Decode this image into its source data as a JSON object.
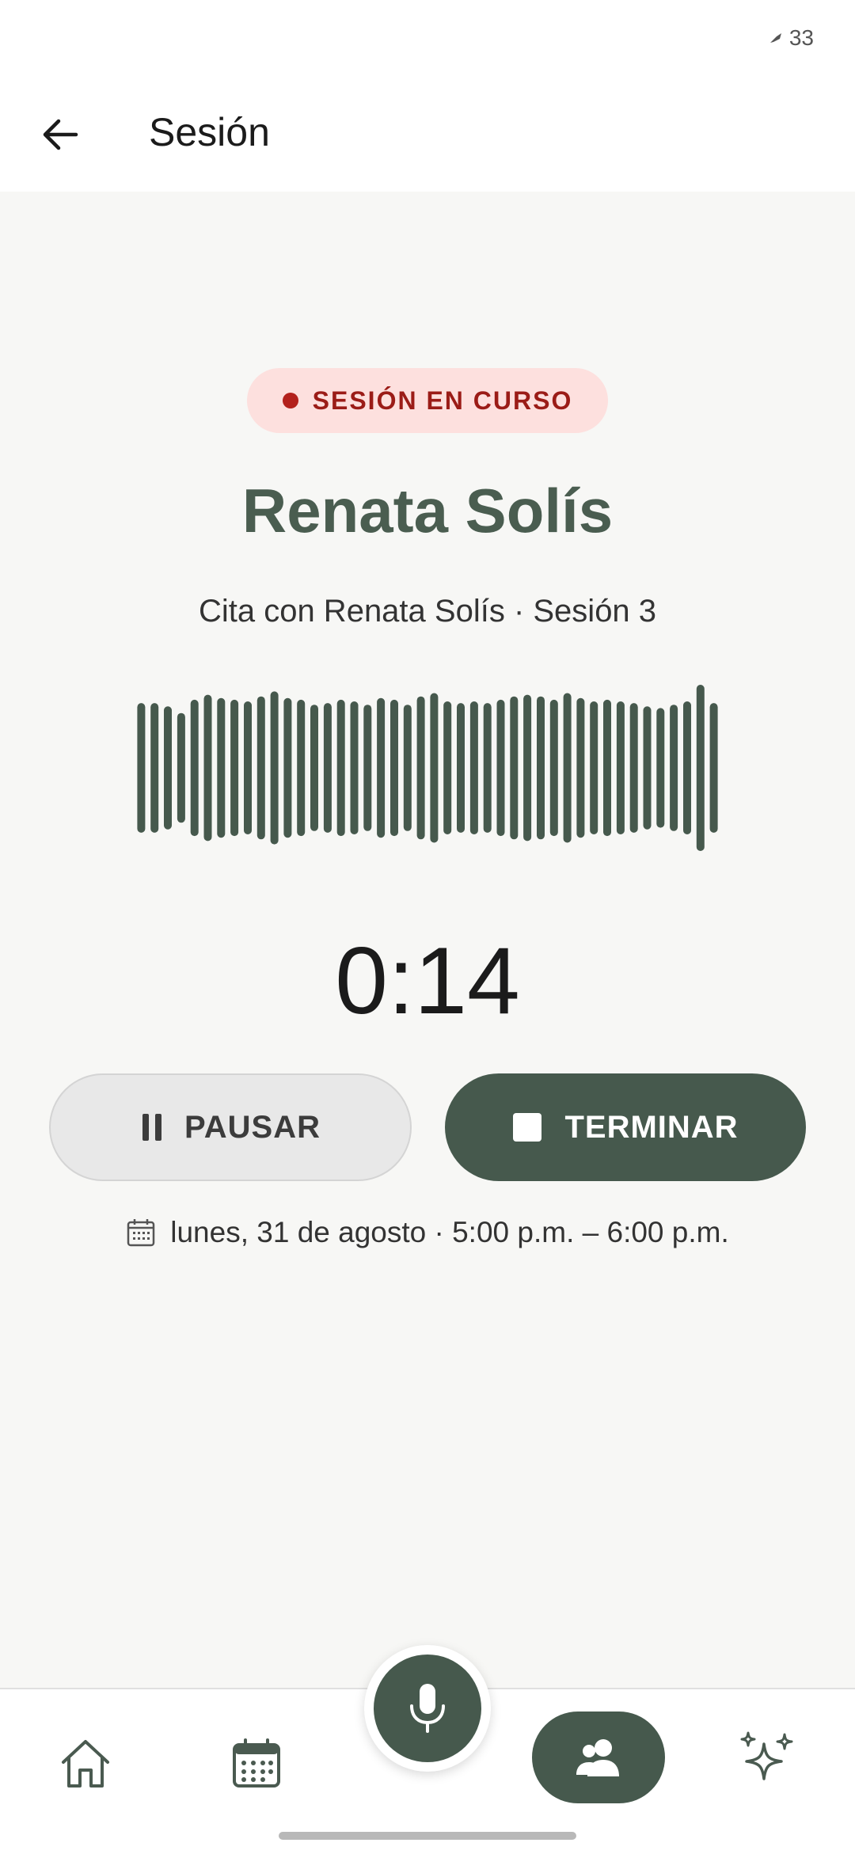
{
  "status_bar": {
    "battery": "33",
    "battery_icon": "battery-saver-icon"
  },
  "app_bar": {
    "title": "Sesión",
    "back_icon": "arrow-left-icon"
  },
  "badge": {
    "label": "SESIÓN EN CURSO",
    "dot_color": "#b3211c"
  },
  "client": {
    "name": "Renata Solís",
    "subtitle": "Cita con Renata Solís · Sesión 3"
  },
  "recording": {
    "elapsed": "0:14",
    "waveform_levels": [
      0.78,
      0.78,
      0.74,
      0.66,
      0.82,
      0.88,
      0.84,
      0.82,
      0.8,
      0.86,
      0.92,
      0.84,
      0.82,
      0.76,
      0.78,
      0.82,
      0.8,
      0.76,
      0.84,
      0.82,
      0.76,
      0.86,
      0.9,
      0.8,
      0.78,
      0.8,
      0.78,
      0.82,
      0.86,
      0.88,
      0.86,
      0.82,
      0.9,
      0.84,
      0.8,
      0.82,
      0.8,
      0.78,
      0.74,
      0.72,
      0.76,
      0.8,
      1.0,
      0.78
    ],
    "accent_color": "#46594d"
  },
  "actions": {
    "pause_label": "PAUSAR",
    "pause_icon": "pause-icon",
    "end_label": "TERMINAR",
    "end_icon": "stop-icon"
  },
  "schedule": {
    "icon": "calendar-icon",
    "text": "lunes, 31 de agosto · 5:00 p.m. – 6:00 p.m."
  },
  "bottom_nav": {
    "items": [
      {
        "id": "home",
        "icon": "home-icon",
        "active": false
      },
      {
        "id": "calendar",
        "icon": "calendar-grid-icon",
        "active": false
      },
      {
        "id": "record",
        "icon": "microphone-icon",
        "active": false
      },
      {
        "id": "clients",
        "icon": "people-icon",
        "active": true
      },
      {
        "id": "ai",
        "icon": "sparkles-icon",
        "active": false
      }
    ]
  }
}
